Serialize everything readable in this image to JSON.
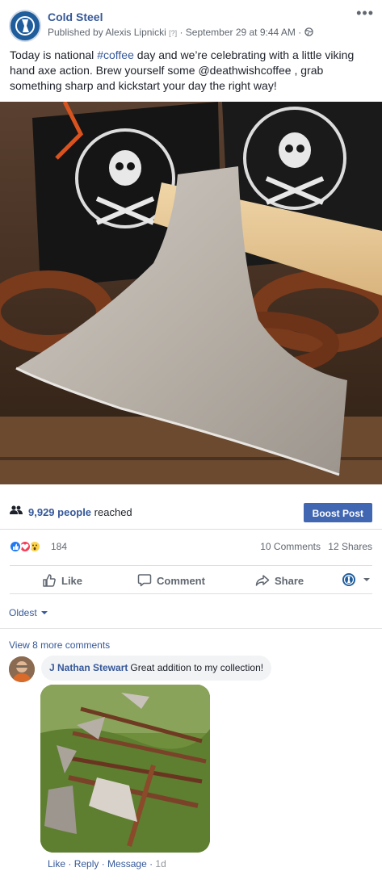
{
  "post": {
    "page_name": "Cold Steel",
    "publisher_prefix": "Published by",
    "publisher": "Alexis Lipnicki",
    "help": "[?]",
    "date": "September 29 at 9:44 AM",
    "text_before": "Today is national ",
    "hashtag": "#coffee",
    "text_after": " day and we’re celebrating with a little viking hand axe action. Brew yourself some @deathwishcoffee , grab something sharp and kickstart your day the right way!"
  },
  "insights": {
    "reached_count": "9,929 people",
    "reached_suffix": "reached",
    "boost_label": "Boost Post"
  },
  "engagement": {
    "reaction_count": "184",
    "comments": "10 Comments",
    "shares": "12 Shares",
    "reaction_colors": {
      "like": "#2078f4",
      "love": "#f33e58",
      "wow": "#fcd34d"
    }
  },
  "actions": {
    "like": "Like",
    "comment": "Comment",
    "share": "Share"
  },
  "comments": {
    "sort_label": "Oldest",
    "view_more": "View 8 more comments",
    "items": [
      {
        "author": "J Nathan Stewart",
        "text": "Great addition to my collection!",
        "like": "Like",
        "reply": "Reply",
        "message": "Message",
        "time": "1d"
      }
    ]
  }
}
